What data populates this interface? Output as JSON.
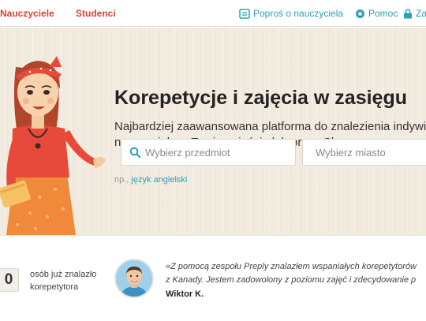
{
  "nav": {
    "teachers": "Nauczyciele",
    "students": "Studenci",
    "ask_teacher": "Poproś o nauczyciela",
    "help": "Pomoc",
    "login": "Zal"
  },
  "hero": {
    "title": "Korepetycje i zajęcia w zasięgu",
    "subtitle_line1": "Najbardziej zaawansowana platforma do znalezienia indywi",
    "subtitle_line2": "nauczyciela w Twoim mieście lub przez Skype",
    "subject_placeholder": "Wybierz przedmiot",
    "city_placeholder": "Wybierz miasto",
    "hint_prefix": "np.,",
    "hint_link": "język angielski"
  },
  "stats": {
    "count": "0",
    "label_line1": "osób już znalazło",
    "label_line2": "korepetytora"
  },
  "testimonial": {
    "quote_line1": "«Z pomocą zespołu Preply znalazłem wspaniałych korepetytorów",
    "quote_line2": "z Kanady. Jestem zadowolony z poziomu zajęć i zdecydowanie p",
    "author": "Wiktor K."
  },
  "colors": {
    "brand_red": "#d9412e",
    "link_teal": "#2aa2b5",
    "hero_bg": "#f3ece1"
  },
  "icons": [
    "ticket-icon",
    "globe-icon",
    "lock-icon",
    "search-icon",
    "location-pin-icon"
  ]
}
